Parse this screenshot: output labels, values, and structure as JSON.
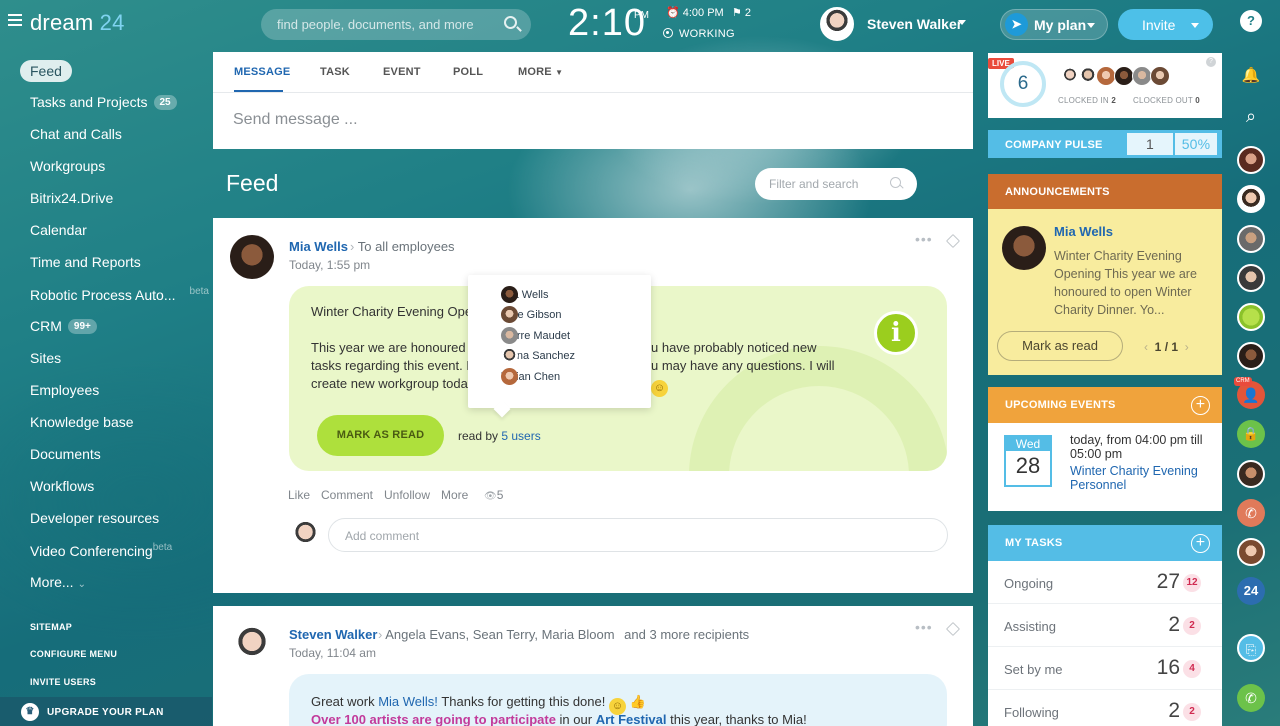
{
  "header": {
    "logo_a": "dream",
    "logo_b": "24",
    "search_placeholder": "find people, documents, and more",
    "clock": "2:10",
    "ampm": "PM",
    "alarm": "⏰ 4:00 PM",
    "flag": "⚑ 2",
    "working": "WORKING",
    "user_name": "Steven Walker",
    "myplan": "My plan",
    "invite": "Invite"
  },
  "nav": {
    "items": [
      {
        "label": "Feed"
      },
      {
        "label": "Tasks and Projects",
        "badge": "25"
      },
      {
        "label": "Chat and Calls"
      },
      {
        "label": "Workgroups"
      },
      {
        "label": "Bitrix24.Drive"
      },
      {
        "label": "Calendar"
      },
      {
        "label": "Time and Reports"
      },
      {
        "label": "Robotic Process Auto...",
        "sup": "beta"
      },
      {
        "label": "CRM",
        "badge": "99+"
      },
      {
        "label": "Sites"
      },
      {
        "label": "Employees"
      },
      {
        "label": "Knowledge base"
      },
      {
        "label": "Documents"
      },
      {
        "label": "Workflows"
      },
      {
        "label": "Developer resources"
      },
      {
        "label": "Video Conferencing",
        "sup": "beta"
      },
      {
        "label": "More..."
      }
    ],
    "sitemap": "SITEMAP",
    "configure": "CONFIGURE MENU",
    "invite_users": "INVITE USERS",
    "upgrade": "UPGRADE YOUR PLAN"
  },
  "composer": {
    "tabs": [
      "MESSAGE",
      "TASK",
      "EVENT",
      "POLL",
      "MORE"
    ],
    "placeholder": "Send message ..."
  },
  "feed": {
    "title": "Feed",
    "filter_placeholder": "Filter and search"
  },
  "post1": {
    "author": "Mia Wells",
    "to": "To all employees",
    "date": "Today, 1:55 pm",
    "line1": "Winter Charity Evening Oper",
    "body_l1a": "This year we are honoured t",
    "body_l1b": "u have probably noticed new",
    "body_l2a": "tasks regarding this event. F",
    "body_l2b": "u may have any questions. I will",
    "body_l3a": "create new workgroup today",
    "mark_read": "MARK AS READ",
    "read_by_prefix": "read by",
    "read_by_link": "5 users",
    "readers": [
      "Mia Wells",
      "Kate Gibson",
      "Pierre Maudet",
      "Elena Sanchez",
      "Vivian Chen"
    ],
    "actions": [
      "Like",
      "Comment",
      "Unfollow",
      "More"
    ],
    "views": "5",
    "comment_placeholder": "Add comment"
  },
  "post2": {
    "author": "Steven Walker",
    "to": "Angela Evans, Sean Terry, Maria Bloom",
    "to_more": "and 3 more recipients",
    "date": "Today, 11:04 am",
    "line1a": "Great work",
    "line1b": "Mia Wells!",
    "line1c": "Thanks for getting this done!",
    "line2a": "Over 100 artists are going to participate",
    "line2b": "in our",
    "line2c": "Art Festival",
    "line2d": "this year, thanks to Mia!"
  },
  "right": {
    "live": "LIVE",
    "live_count": "6",
    "clocked_in_label": "CLOCKED IN",
    "clocked_in": "2",
    "clocked_out_label": "CLOCKED OUT",
    "clocked_out": "0",
    "pulse_label": "COMPANY PULSE",
    "pulse_value": "1",
    "pulse_percent": "50%",
    "announcements_label": "ANNOUNCEMENTS",
    "ann_name": "Mia Wells",
    "ann_text": "Winter Charity Evening Opening This year we are honoured to open Winter Charity Dinner. Yo...",
    "ann_mark": "Mark as read",
    "ann_page": "1",
    "ann_total": "1",
    "events_label": "UPCOMING EVENTS",
    "ev_weekday": "Wed",
    "ev_day": "28",
    "ev_time": "today, from 04:00 pm till 05:00 pm",
    "ev_title": "Winter Charity Evening Personnel",
    "tasks_label": "MY TASKS",
    "tasks": [
      {
        "label": "Ongoing",
        "value": "27",
        "count": "12"
      },
      {
        "label": "Assisting",
        "value": "2",
        "count": "2"
      },
      {
        "label": "Set by me",
        "value": "16",
        "count": "4"
      },
      {
        "label": "Following",
        "value": "2",
        "count": "2"
      }
    ]
  },
  "rail": {
    "crm_badge": "CRM",
    "b24": "24"
  },
  "colors": {
    "accent_blue": "#2067b0",
    "sky": "#54bde6",
    "green": "#aee03c",
    "announce": "#c96d2e",
    "events": "#f0a33c"
  }
}
